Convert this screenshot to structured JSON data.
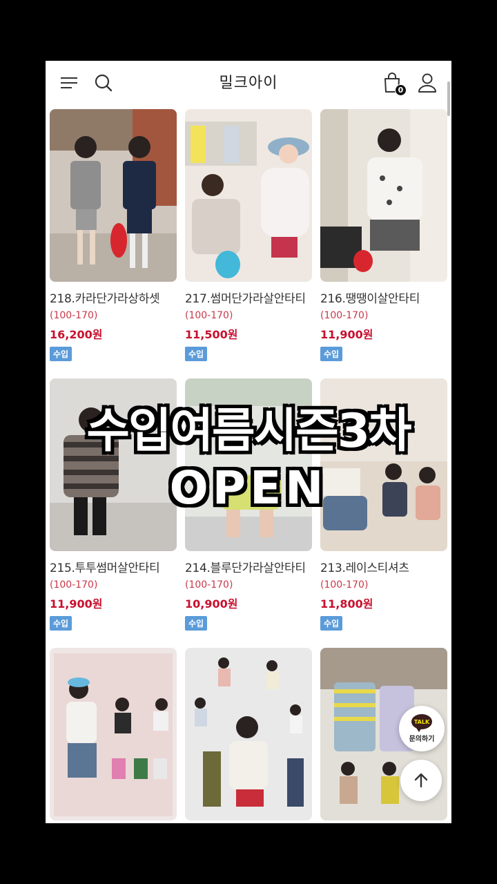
{
  "header": {
    "title": "밀크아이",
    "cart_count": "0",
    "icons": [
      "menu-icon",
      "search-icon",
      "cart-icon",
      "user-icon"
    ]
  },
  "products": [
    {
      "name": "218.카라단가라상하셋",
      "size": "(100-170)",
      "price": "16,200원",
      "badge": "수입"
    },
    {
      "name": "217.썸머단가라살안타티",
      "size": "(100-170)",
      "price": "11,500원",
      "badge": "수입"
    },
    {
      "name": "216.땡땡이살안타티",
      "size": "(100-170)",
      "price": "11,900원",
      "badge": "수입"
    },
    {
      "name": "215.투투썸머살안타티",
      "size": "(100-170)",
      "price": "11,900원",
      "badge": "수입"
    },
    {
      "name": "214.블루단가라살안타티",
      "size": "(100-170)",
      "price": "10,900원",
      "badge": "수입"
    },
    {
      "name": "213.레이스티셔츠",
      "size": "(100-170)",
      "price": "11,800원",
      "badge": "수입"
    }
  ],
  "promo": {
    "line1": "수입여름시즌3차",
    "line2": "OPEN"
  },
  "floating": {
    "talk_badge": "TALK",
    "talk_label": "문의하기"
  },
  "colors": {
    "price": "#c8102e",
    "size": "#c8384a",
    "badge": "#5b9bd9"
  }
}
